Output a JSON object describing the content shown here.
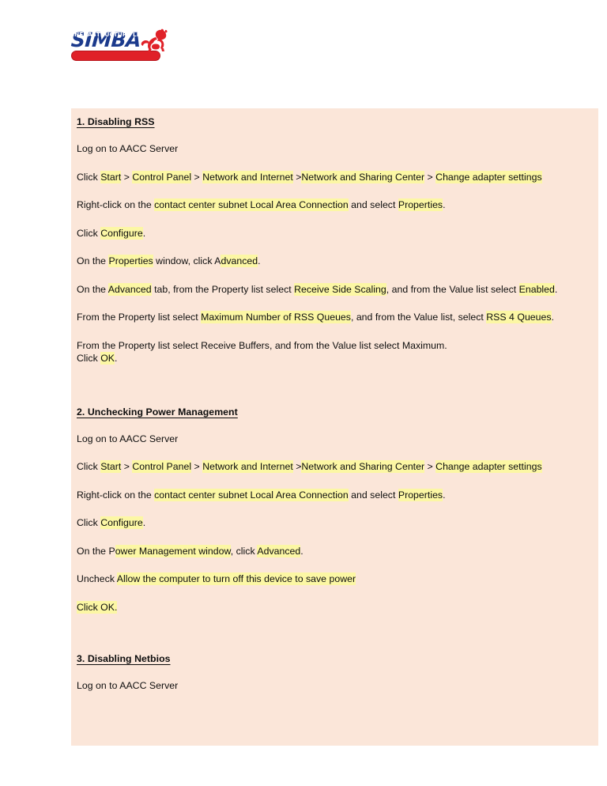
{
  "logo": {
    "wordmark": "SIMBA",
    "banner": "INFRASTRUCTURE LIMITED",
    "mark_name": "lion-icon",
    "wordmark_color": "#1b3a8c",
    "banner_color": "#e02128"
  },
  "document": {
    "panel_bg": "#fbe6d9",
    "highlight_color": "#fcf7a4",
    "text_color": "#0d0d0d"
  },
  "sections": [
    {
      "heading": "1. Disabling RSS",
      "paragraphs": [
        {
          "id": "s1-logon",
          "runs": [
            {
              "t": "Log on to AACC Server",
              "h": false
            }
          ]
        },
        {
          "id": "s1-navigate",
          "runs": [
            {
              "t": "Click ",
              "h": false
            },
            {
              "t": "Start",
              "h": true
            },
            {
              "t": " > ",
              "h": false
            },
            {
              "t": "Control Panel",
              "h": true
            },
            {
              "t": " > ",
              "h": false
            },
            {
              "t": "Network and Internet",
              "h": true
            },
            {
              "t": " >",
              "h": false
            },
            {
              "t": "Network and Sharing Center",
              "h": true
            },
            {
              "t": " > ",
              "h": false
            },
            {
              "t": "Change adapter settings",
              "h": true
            }
          ]
        },
        {
          "id": "s1-rightclick",
          "runs": [
            {
              "t": "Right-click on the ",
              "h": false
            },
            {
              "t": "contact center subnet Local Area Connection",
              "h": true
            },
            {
              "t": " and select ",
              "h": false
            },
            {
              "t": "Properties",
              "h": true
            },
            {
              "t": ".",
              "h": false
            }
          ]
        },
        {
          "id": "s1-configure",
          "runs": [
            {
              "t": "Click ",
              "h": false
            },
            {
              "t": "Configure",
              "h": true
            },
            {
              "t": ".",
              "h": false
            }
          ]
        },
        {
          "id": "s1-properties-window",
          "runs": [
            {
              "t": "On the ",
              "h": false
            },
            {
              "t": "Properties",
              "h": true
            },
            {
              "t": " window, click A",
              "h": false
            },
            {
              "t": "dvanced",
              "h": true
            },
            {
              "t": ".",
              "h": false
            }
          ]
        },
        {
          "id": "s1-advanced-tab",
          "runs": [
            {
              "t": "On the ",
              "h": false
            },
            {
              "t": "Advanced",
              "h": true
            },
            {
              "t": " tab, from the Property list select ",
              "h": false
            },
            {
              "t": "Receive Side Scaling",
              "h": true
            },
            {
              "t": ", and from the Value list select ",
              "h": false
            },
            {
              "t": "Enabled",
              "h": true
            },
            {
              "t": ".",
              "h": false
            }
          ]
        },
        {
          "id": "s1-rss-queues",
          "runs": [
            {
              "t": "From the Property list select ",
              "h": false
            },
            {
              "t": "Maximum Number of RSS Queues",
              "h": true
            },
            {
              "t": ", and from the Value list, select ",
              "h": false
            },
            {
              "t": "RSS 4 Queues",
              "h": true
            },
            {
              "t": ".",
              "h": false
            }
          ]
        },
        {
          "id": "s1-receive-buffers",
          "runs": [
            {
              "t": "From the Property list select Receive Buffers, and from the Value list select Maximum.",
              "h": false
            },
            {
              "t": "\n",
              "h": false
            },
            {
              "t": "Click ",
              "h": false
            },
            {
              "t": "OK",
              "h": true
            },
            {
              "t": ".",
              "h": false
            }
          ]
        }
      ]
    },
    {
      "heading": "2. Unchecking Power Management",
      "paragraphs": [
        {
          "id": "s2-logon",
          "runs": [
            {
              "t": "Log on to AACC Server",
              "h": false
            }
          ]
        },
        {
          "id": "s2-navigate",
          "runs": [
            {
              "t": "Click ",
              "h": false
            },
            {
              "t": "Start",
              "h": true
            },
            {
              "t": " > ",
              "h": false
            },
            {
              "t": "Control Panel",
              "h": true
            },
            {
              "t": " > ",
              "h": false
            },
            {
              "t": "Network and Internet",
              "h": true
            },
            {
              "t": " >",
              "h": false
            },
            {
              "t": "Network and Sharing Center",
              "h": true
            },
            {
              "t": " > ",
              "h": false
            },
            {
              "t": "Change adapter settings",
              "h": true
            }
          ]
        },
        {
          "id": "s2-rightclick",
          "runs": [
            {
              "t": "Right-click on the ",
              "h": false
            },
            {
              "t": "contact center subnet Local Area Connection",
              "h": true
            },
            {
              "t": " and select ",
              "h": false
            },
            {
              "t": "Properties",
              "h": true
            },
            {
              "t": ".",
              "h": false
            }
          ]
        },
        {
          "id": "s2-configure",
          "runs": [
            {
              "t": "Click ",
              "h": false
            },
            {
              "t": "Configure",
              "h": true
            },
            {
              "t": ".",
              "h": false
            }
          ]
        },
        {
          "id": "s2-power-window",
          "runs": [
            {
              "t": "On the P",
              "h": false
            },
            {
              "t": "ower Management window",
              "h": true
            },
            {
              "t": ", click ",
              "h": false
            },
            {
              "t": "Advanced",
              "h": true
            },
            {
              "t": ".",
              "h": false
            }
          ]
        },
        {
          "id": "s2-uncheck",
          "runs": [
            {
              "t": "Uncheck ",
              "h": false
            },
            {
              "t": "Allow the computer to turn off this device to save power",
              "h": true
            }
          ]
        },
        {
          "id": "s2-ok",
          "runs": [
            {
              "t": "Click OK.",
              "h": true
            }
          ]
        }
      ]
    },
    {
      "heading": "3. Disabling Netbios",
      "paragraphs": [
        {
          "id": "s3-logon",
          "runs": [
            {
              "t": "Log on to AACC Server",
              "h": false
            }
          ]
        }
      ]
    }
  ]
}
